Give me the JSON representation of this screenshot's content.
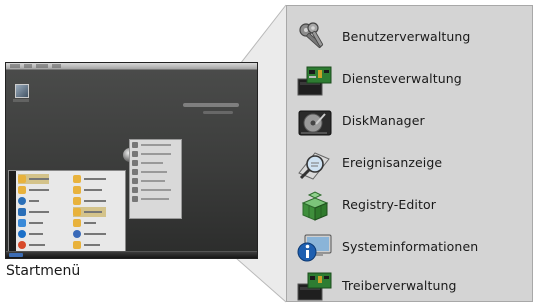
{
  "caption": "Startmenü",
  "panel": {
    "items": [
      {
        "label": "Benutzerverwaltung",
        "icon": "keys-icon"
      },
      {
        "label": "Diensteverwaltung",
        "icon": "services-icon"
      },
      {
        "label": "DiskManager",
        "icon": "hard-disk-icon"
      },
      {
        "label": "Ereignisanzeige",
        "icon": "event-viewer-icon"
      },
      {
        "label": "Registry-Editor",
        "icon": "registry-icon"
      },
      {
        "label": "Systeminformationen",
        "icon": "system-info-icon"
      },
      {
        "label": "Treiberverwaltung",
        "icon": "driver-icon"
      }
    ]
  },
  "colors": {
    "panel_background": "#d4d4d4",
    "desktop_background": "#3b3c3b",
    "startmenu_selection": "#d4c38a"
  }
}
